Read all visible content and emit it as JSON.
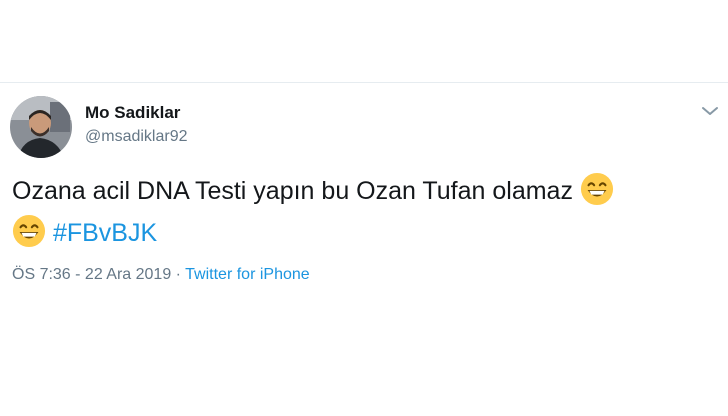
{
  "tweet": {
    "author": {
      "display_name": "Mo Sadiklar",
      "handle": "@msadiklar92"
    },
    "text_main": "Ozana acil DNA Testi yapın bu Ozan Tufan olamaz",
    "hashtag": "#FBvBJK",
    "emoji": "grinning-face-with-smiling-eyes",
    "time": "ÖS 7:36",
    "date": "22 Ara 2019",
    "separator_1": " - ",
    "separator_2": " · ",
    "source": "Twitter for iPhone",
    "colors": {
      "link": "#1b95e0",
      "text": "#14171a",
      "muted": "#657786"
    }
  }
}
